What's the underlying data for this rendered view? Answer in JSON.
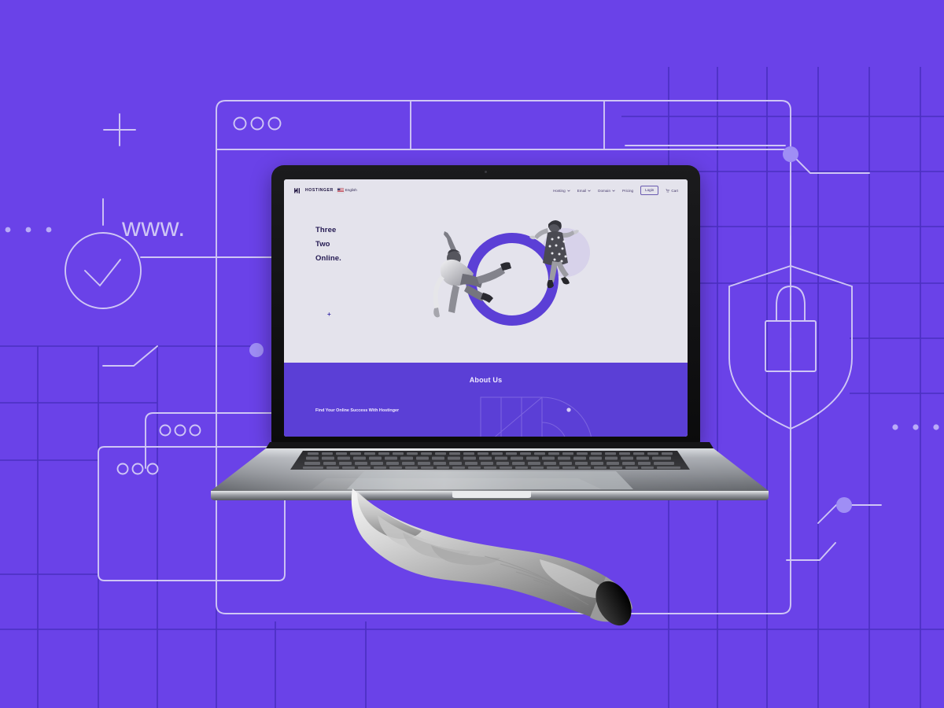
{
  "scene": {
    "description": "Hostinger promotional hero image: a hand holds a MacBook showing the Hostinger website, over a purple background with web-themed line art",
    "background_color": "#6a42e8",
    "accent_purple": "#5b3fd6",
    "line_color": "#cfc6f5",
    "grid_color": "#4a2fc0",
    "node_color": "#9f8ef5"
  },
  "background": {
    "www_label": "www.",
    "decorations": [
      {
        "name": "plus-marker",
        "label": "+"
      },
      {
        "name": "check-circle-icon",
        "label": "check"
      },
      {
        "name": "shield-lock-icon",
        "label": "shield with padlock"
      },
      {
        "name": "browser-window-outline",
        "label": "browser window"
      },
      {
        "name": "circuit-node-dot",
        "label": "node"
      },
      {
        "name": "grid-lines",
        "label": "grid"
      }
    ],
    "browser_dots_count": 3
  },
  "device": {
    "name": "laptop",
    "brand_style": "macbook",
    "body_color": "#b9bcc1",
    "bezel_color": "#141416",
    "screen_bg": "#e4e3ec"
  },
  "website": {
    "nav": {
      "logo_text": "HOSTINGER",
      "language": {
        "label": "English",
        "flag": "us-flag-icon"
      },
      "links": [
        {
          "label": "Hosting",
          "has_dropdown": true
        },
        {
          "label": "Email",
          "has_dropdown": true
        },
        {
          "label": "Domain",
          "has_dropdown": true
        },
        {
          "label": "Pricing",
          "has_dropdown": false
        }
      ],
      "login_label": "Login",
      "cart_label": "Cart"
    },
    "hero": {
      "headline_lines": [
        "Three",
        "Two",
        "Online."
      ],
      "headline_color": "#241a52",
      "plus_marker": "+",
      "art": {
        "ring_color": "#5b3fd6",
        "blob_color": "#d7d2ea",
        "figures": [
          "jumping-man",
          "jumping-woman"
        ]
      }
    },
    "about": {
      "title": "About Us",
      "subtitle": "Find Your Online Success With Hostinger",
      "background": "#5b3fd6",
      "text_color": "#efeaff"
    }
  },
  "hand": {
    "name": "hand-holding-laptop",
    "style": "black-and-white-photo"
  }
}
